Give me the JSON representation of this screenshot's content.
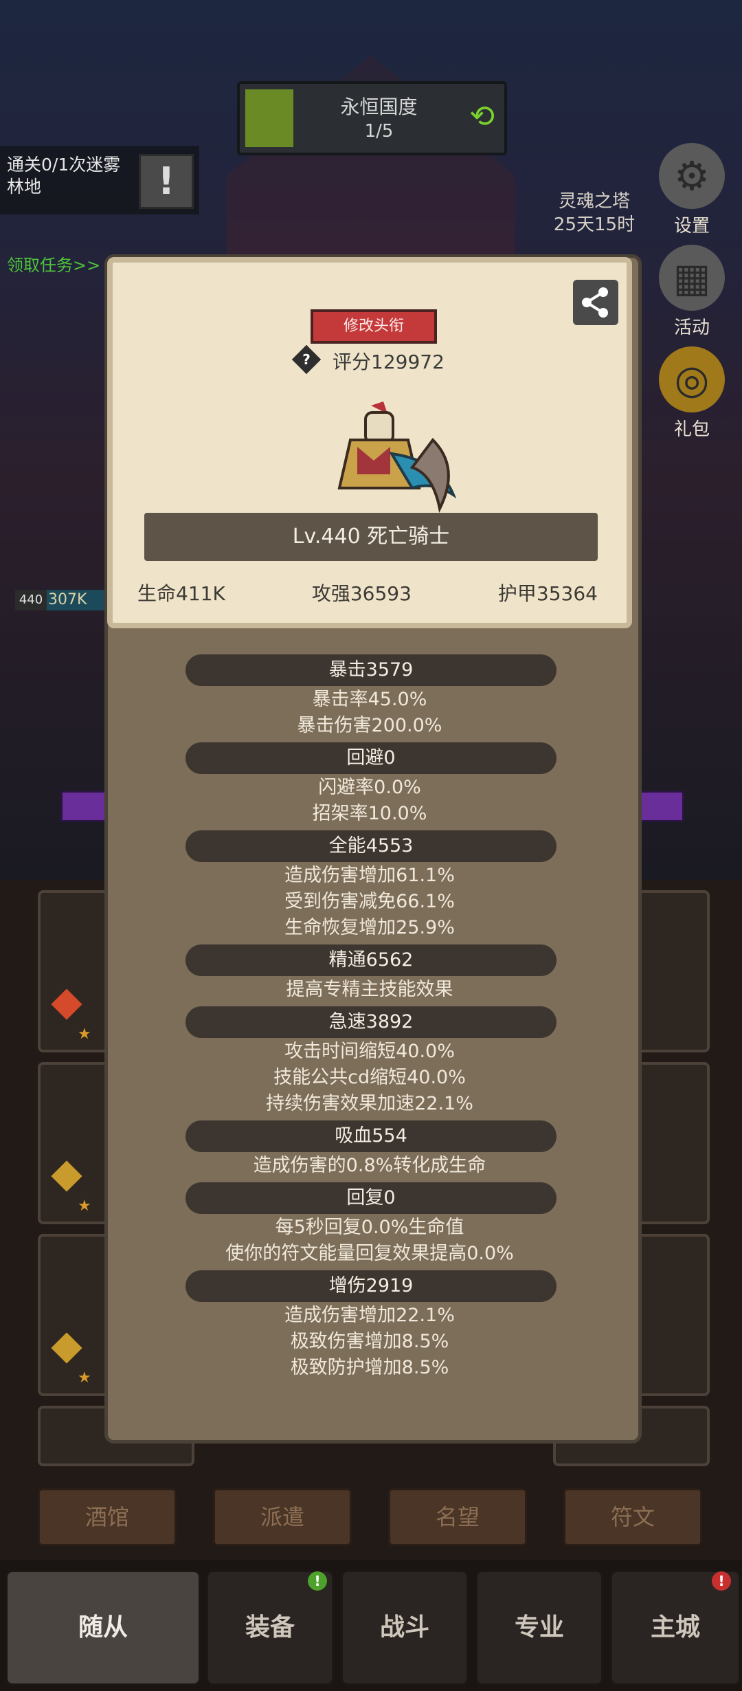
{
  "zone": {
    "name": "永恒国度",
    "progress": "1/5"
  },
  "quest": {
    "text": "通关0/1次迷雾林地",
    "claim": "领取任务>>"
  },
  "right_menu": {
    "tower_name": "灵魂之塔",
    "tower_time": "25天15时",
    "settings": "设置",
    "activity": "活动",
    "gift": "礼包"
  },
  "battle_hp": {
    "level": "440",
    "value": "307K"
  },
  "hero": {
    "modify_title_button": "修改头衔",
    "score": "评分129972",
    "name": "Lv.440 死亡骑士",
    "hp": "生命411K",
    "attack": "攻强36593",
    "armor": "护甲35364"
  },
  "attributes": [
    {
      "title": "暴击3579",
      "details": [
        "暴击率45.0%",
        "暴击伤害200.0%"
      ]
    },
    {
      "title": "回避0",
      "details": [
        "闪避率0.0%",
        "招架率10.0%"
      ]
    },
    {
      "title": "全能4553",
      "details": [
        "造成伤害增加61.1%",
        "受到伤害减免66.1%",
        "生命恢复增加25.9%"
      ]
    },
    {
      "title": "精通6562",
      "details": [
        "提高专精主技能效果"
      ]
    },
    {
      "title": "急速3892",
      "details": [
        "攻击时间缩短40.0%",
        "技能公共cd缩短40.0%",
        "持续伤害效果加速22.1%"
      ]
    },
    {
      "title": "吸血554",
      "details": [
        "造成伤害的0.8%转化成生命"
      ]
    },
    {
      "title": "回复0",
      "details": [
        "每5秒回复0.0%生命值",
        "使你的符文能量回复效果提高0.0%"
      ]
    },
    {
      "title": "增伤2919",
      "details": [
        "造成伤害增加22.1%",
        "极致伤害增加8.5%",
        "极致防护增加8.5%"
      ]
    }
  ],
  "categories": [
    "酒馆",
    "派遣",
    "名望",
    "符文"
  ],
  "nav": [
    "随从",
    "装备",
    "战斗",
    "专业",
    "主城"
  ],
  "colors": {
    "accent_green": "#7bd12d",
    "title_red": "#c43a3a",
    "panel": "#7d6e59"
  }
}
